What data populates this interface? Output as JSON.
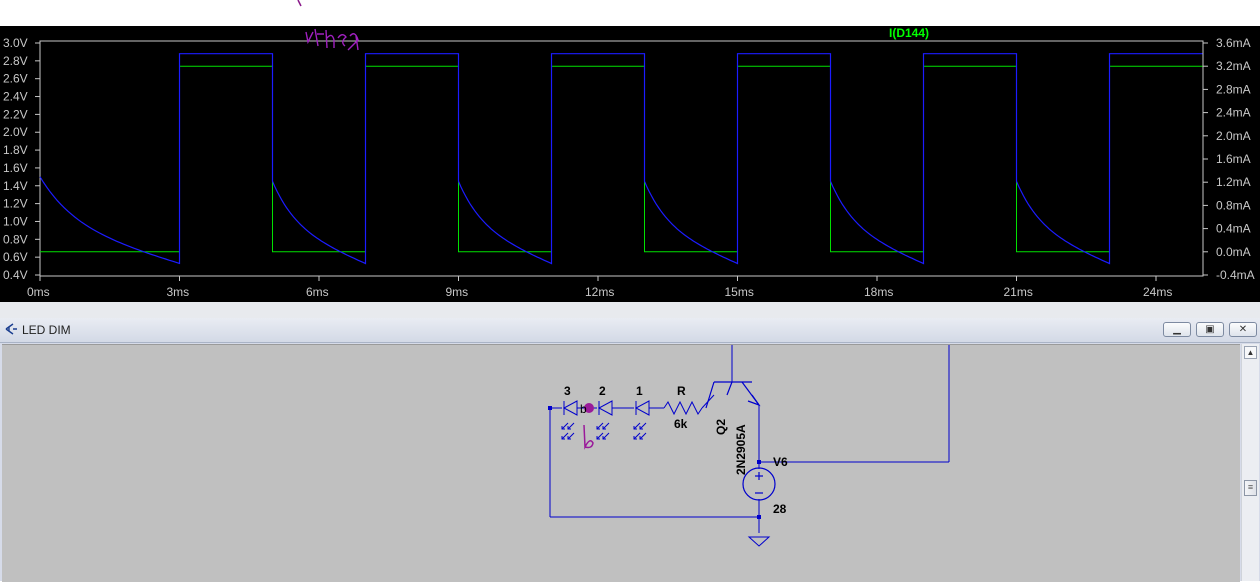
{
  "waveform": {
    "trace_label": "I(D144)",
    "y_left_ticks": [
      "3.0V",
      "2.8V",
      "2.6V",
      "2.4V",
      "2.2V",
      "2.0V",
      "1.8V",
      "1.6V",
      "1.4V",
      "1.2V",
      "1.0V",
      "0.8V",
      "0.6V",
      "0.4V"
    ],
    "y_right_ticks": [
      "3.6mA",
      "3.2mA",
      "2.8mA",
      "2.4mA",
      "2.0mA",
      "1.6mA",
      "1.2mA",
      "0.8mA",
      "0.4mA",
      "0.0mA",
      "-0.4mA"
    ],
    "x_ticks": [
      "0ms",
      "3ms",
      "6ms",
      "9ms",
      "12ms",
      "15ms",
      "18ms",
      "21ms",
      "24ms"
    ],
    "colors": {
      "background": "#000000",
      "voltage_trace": "#1c1cff",
      "current_trace": "#00e000",
      "axis": "#c8c8c8"
    },
    "annotation_text": "Vth"
  },
  "window": {
    "title": "LED DIM",
    "buttons": {
      "minimize": "▁",
      "restore": "▣",
      "close": "✕"
    }
  },
  "schematic": {
    "diode_labels": [
      "3",
      "2",
      "1"
    ],
    "resistor_name": "R",
    "resistor_value": "6k",
    "transistor_name": "Q2",
    "transistor_model": "2N2905A",
    "source_name": "V6",
    "source_value": "28",
    "net_label": "b",
    "handwritten_mark": "b",
    "wire_color": "#0000cc"
  }
}
